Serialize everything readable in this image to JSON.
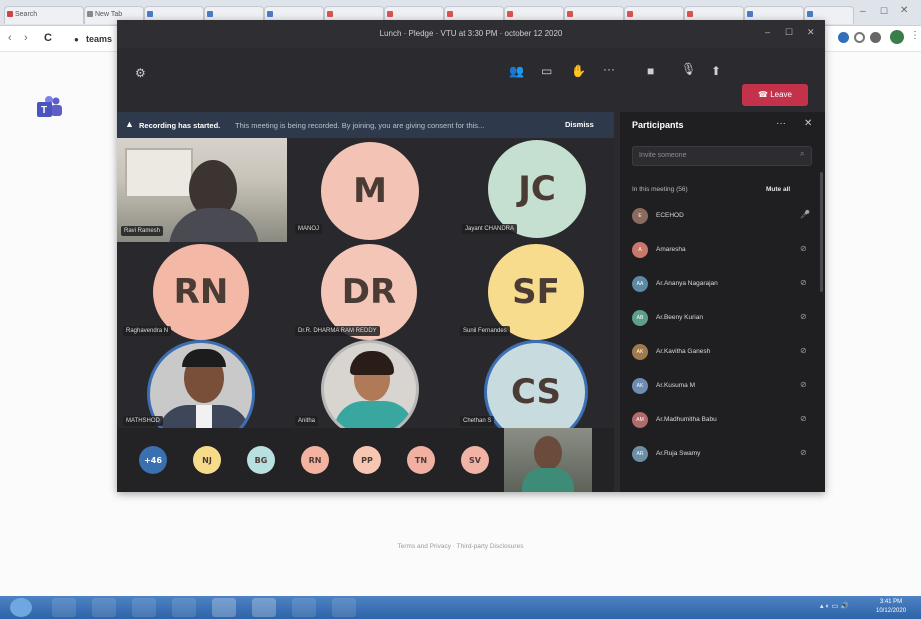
{
  "browser": {
    "tabs": [
      "Search",
      "New Tab",
      "",
      "",
      "",
      "",
      "",
      "",
      "",
      "",
      "",
      "",
      "",
      ""
    ],
    "url": "teams",
    "nav": {
      "back": "‹",
      "forward": "›",
      "reload": "C"
    }
  },
  "meeting": {
    "title": "Lunch · Pledge · VTU at 3:30 PM · october 12 2020",
    "leave_label": "Leave",
    "recording": {
      "title": "Recording has started.",
      "text": "This meeting is being recorded. By joining, you are giving consent for this...",
      "dismiss": "Dismiss"
    },
    "tiles": [
      {
        "initials": "",
        "name": "Ravi Ramesh",
        "color": ""
      },
      {
        "initials": "M",
        "name": "MANOJ",
        "color": "#f3c3b6"
      },
      {
        "initials": "JC",
        "name": "Jayant CHANDRA",
        "color": "#c5dfd0"
      },
      {
        "initials": "RN",
        "name": "Raghavendra N",
        "color": "#f4b8a6"
      },
      {
        "initials": "DR",
        "name": "Dr.R. DHARMA RAM REDDY",
        "color": "#f3c6b8"
      },
      {
        "initials": "SF",
        "name": "Sunil Fernandes",
        "color": "#f7dc8e"
      },
      {
        "initials": "",
        "name": "MATHSHOD",
        "color": ""
      },
      {
        "initials": "",
        "name": "Anitha",
        "color": ""
      },
      {
        "initials": "CS",
        "name": "Chethan S",
        "color": "#c8dce0"
      }
    ],
    "bottom_avatars": [
      {
        "initials": "+46",
        "color": "#3a6fb0"
      },
      {
        "initials": "NJ",
        "color": "#f6dc8a"
      },
      {
        "initials": "BG",
        "color": "#b8e0e0"
      },
      {
        "initials": "RN",
        "color": "#f4b3a0"
      },
      {
        "initials": "PP",
        "color": "#f6c6b2"
      },
      {
        "initials": "TN",
        "color": "#f2b0a2"
      },
      {
        "initials": "SV",
        "color": "#f1b3a5"
      }
    ]
  },
  "participants": {
    "title": "Participants",
    "search_placeholder": "Invite someone",
    "section": "In this meeting (56)",
    "mute_all": "Mute all",
    "list": [
      {
        "name": "ECEHOD",
        "initials": "E",
        "color": "#8b6b5e"
      },
      {
        "initials": "A",
        "name": "Amaresha",
        "color": "#c9786b"
      },
      {
        "initials": "AA",
        "name": "Ar.Ananya Nagarajan",
        "color": "#5c8aa3"
      },
      {
        "initials": "AB",
        "name": "Ar.Beeny Kurian",
        "color": "#5f9e8c"
      },
      {
        "initials": "AK",
        "name": "Ar.Kavitha Ganesh",
        "color": "#a07a4d"
      },
      {
        "initials": "AK",
        "name": "Ar.Kusuma M",
        "color": "#6f8bb0"
      },
      {
        "initials": "AM",
        "name": "Ar.Madhumitha Babu",
        "color": "#b36a6a"
      },
      {
        "initials": "AR",
        "name": "Ar.Ruja Swamy",
        "color": "#6b8fa6"
      }
    ]
  },
  "footer": {
    "links": "Terms and Privacy · Third-party Disclosures"
  },
  "taskbar": {
    "time": "3:41 PM",
    "date": "10/12/2020"
  }
}
